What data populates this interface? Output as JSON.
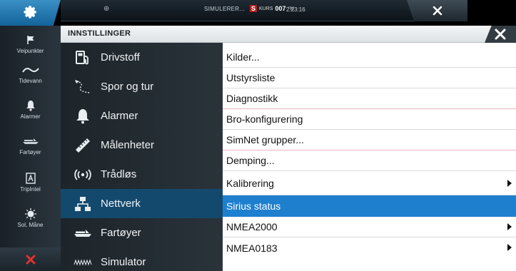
{
  "top_bar": {
    "home_icon": "gear-icon",
    "sim_label": "SIMULERER...",
    "kurs": {
      "letter": "S",
      "label": "KURS",
      "value": "007",
      "unit": "°M"
    },
    "clock": "2:23:16",
    "close_icon": "close-icon"
  },
  "left_nav": {
    "items": [
      {
        "label": "Veipunkter",
        "icon": "flag-icon"
      },
      {
        "label": "Tidevann",
        "icon": "tide-wave-icon"
      },
      {
        "label": "Alarmer",
        "icon": "bell-icon"
      },
      {
        "label": "Fartøyer",
        "icon": "vessel-icon"
      },
      {
        "label": "TripIntel",
        "icon": "tripintel-icon"
      },
      {
        "label": "Sol, Måne",
        "icon": "sun-moon-icon"
      }
    ],
    "close_icon": "close-icon"
  },
  "dialog": {
    "title": "INNSTILLINGER",
    "close_icon": "close-icon",
    "categories": [
      {
        "label": "Drivstoff",
        "icon": "fuel-icon",
        "selected": false
      },
      {
        "label": "Spor og tur",
        "icon": "track-icon",
        "selected": false
      },
      {
        "label": "Alarmer",
        "icon": "bell-icon",
        "selected": false
      },
      {
        "label": "Målenheter",
        "icon": "ruler-icon",
        "selected": false
      },
      {
        "label": "Trådløs",
        "icon": "wireless-icon",
        "selected": false
      },
      {
        "label": "Nettverk",
        "icon": "network-icon",
        "selected": true
      },
      {
        "label": "Fartøyer",
        "icon": "vessel-icon",
        "selected": false
      },
      {
        "label": "Simulator",
        "icon": "simulator-icon",
        "selected": false
      }
    ],
    "options": [
      {
        "label": "Kilder...",
        "submenu": false,
        "selected": false
      },
      {
        "label": "Utstyrsliste",
        "submenu": false,
        "selected": false
      },
      {
        "label": "Diagnostikk",
        "submenu": false,
        "selected": false
      },
      {
        "label": "Bro-konfigurering",
        "submenu": false,
        "selected": false
      },
      {
        "label": "SimNet grupper...",
        "submenu": false,
        "selected": false
      },
      {
        "label": "Demping...",
        "submenu": false,
        "selected": false
      },
      {
        "label": "Kalibrering",
        "submenu": true,
        "selected": false
      },
      {
        "label": "Sirius status",
        "submenu": false,
        "selected": true
      },
      {
        "label": "NMEA2000",
        "submenu": true,
        "selected": false
      },
      {
        "label": "NMEA0183",
        "submenu": true,
        "selected": false
      }
    ]
  },
  "colors": {
    "accent_blue": "#1e7fcf",
    "selected_category": "#14496e",
    "dark_panel": "#1d242a",
    "home_button": "#2a7fb8"
  }
}
